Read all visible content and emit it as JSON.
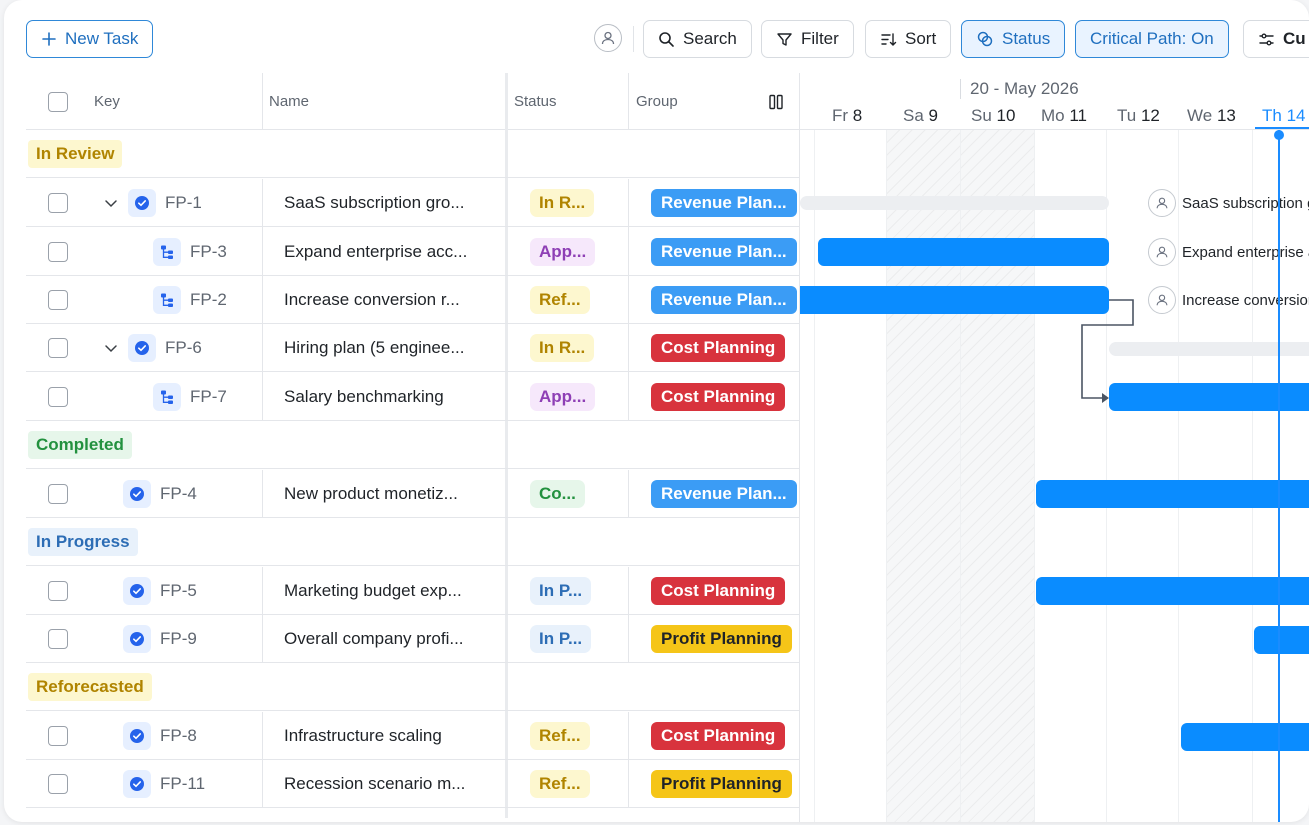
{
  "toolbar": {
    "new_task": "New Task",
    "search": "Search",
    "filter": "Filter",
    "sort": "Sort",
    "status": "Status",
    "critical_path": "Critical Path: On",
    "customize": "Cu"
  },
  "columns": {
    "key": "Key",
    "name": "Name",
    "status": "Status",
    "group": "Group"
  },
  "groups": {
    "in_review": "In Review",
    "completed": "Completed",
    "in_progress": "In Progress",
    "reforecasted": "Reforecasted"
  },
  "rows": [
    {
      "key": "FP-1",
      "name": "SaaS subscription gro...",
      "status": "In R...",
      "group": "Revenue Plan..."
    },
    {
      "key": "FP-3",
      "name": "Expand enterprise acc...",
      "status": "App...",
      "group": "Revenue Plan..."
    },
    {
      "key": "FP-2",
      "name": "Increase conversion r...",
      "status": "Ref...",
      "group": "Revenue Plan..."
    },
    {
      "key": "FP-6",
      "name": "Hiring plan (5 enginee...",
      "status": "In R...",
      "group": "Cost Planning"
    },
    {
      "key": "FP-7",
      "name": "Salary benchmarking",
      "status": "App...",
      "group": "Cost Planning"
    },
    {
      "key": "FP-4",
      "name": "New product monetiz...",
      "status": "Co...",
      "group": "Revenue Plan..."
    },
    {
      "key": "FP-5",
      "name": "Marketing budget exp...",
      "status": "In P...",
      "group": "Cost Planning"
    },
    {
      "key": "FP-9",
      "name": "Overall company profi...",
      "status": "In P...",
      "group": "Profit Planning"
    },
    {
      "key": "FP-8",
      "name": "Infrastructure scaling",
      "status": "Ref...",
      "group": "Cost Planning"
    },
    {
      "key": "FP-11",
      "name": "Recession scenario m...",
      "status": "Ref...",
      "group": "Profit Planning"
    }
  ],
  "timeline": {
    "week": "20 - May 2026",
    "days": [
      {
        "dow": "Fr",
        "num": "8"
      },
      {
        "dow": "Sa",
        "num": "9"
      },
      {
        "dow": "Su",
        "num": "10"
      },
      {
        "dow": "Mo",
        "num": "11"
      },
      {
        "dow": "Tu",
        "num": "12"
      },
      {
        "dow": "We",
        "num": "13"
      },
      {
        "dow": "Th",
        "num": "14"
      }
    ],
    "bar_labels": {
      "fp1": "SaaS subscription g",
      "fp3": "Expand enterprise a",
      "fp2": "Increase conversion"
    }
  },
  "colors": {
    "accent": "#1a8cff",
    "revenue": "#3b9cf5",
    "cost": "#d8333d",
    "profit": "#f5c518",
    "in_review_bg": "#fdf7cf",
    "in_review_fg": "#b08400",
    "completed_bg": "#e6f6ea",
    "completed_fg": "#23913f",
    "in_progress_bg": "#e8f1fb",
    "in_progress_fg": "#2d6db5",
    "approved_bg": "#f6e8fb",
    "approved_fg": "#8e3fb5"
  }
}
